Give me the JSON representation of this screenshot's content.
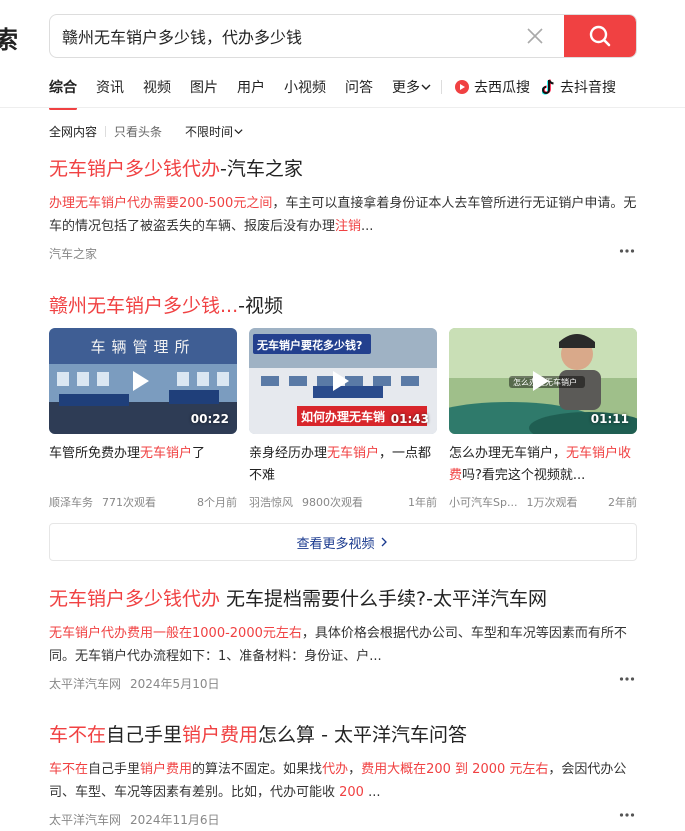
{
  "header": {
    "logo_fragment": "索",
    "search_value": "赣州无车销户多少钱，代办多少钱"
  },
  "tabs": [
    {
      "label": "综合"
    },
    {
      "label": "资讯"
    },
    {
      "label": "视频"
    },
    {
      "label": "图片"
    },
    {
      "label": "用户"
    },
    {
      "label": "小视频"
    },
    {
      "label": "问答"
    }
  ],
  "tab_more_label": "更多",
  "ext_links": [
    {
      "label": "去西瓜搜",
      "icon": "xigua-icon"
    },
    {
      "label": "去抖音搜",
      "icon": "douyin-icon"
    }
  ],
  "filters": [
    "全网内容",
    "只看头条",
    "不限时间"
  ],
  "results": [
    {
      "title_parts": [
        "无车销户多少钱代办",
        "-汽车之家"
      ],
      "snippet_parts": [
        "办理无车销户代办需要200-500元之间",
        "，车主可以直接拿着身份证本人去车管所进行无证销户申请。无车的情况包括了被盗丢失的车辆、报废后没有办理",
        "注销",
        "..."
      ],
      "source": "汽车之家",
      "date": ""
    },
    {
      "title_parts": [
        "无车销户多少钱代办",
        " 无车提档需要什么手续?-太平洋汽车网"
      ],
      "snippet_parts": [
        "无车销户代办费用一般在1000-2000元左右",
        "，具体价格会根据代办公司、车型和车况等因素而有所不同。无车销户代办流程如下：1、准备材料：身份证、户..."
      ],
      "source": "太平洋汽车网",
      "date": "2024年5月10日"
    },
    {
      "title_parts": [
        "车不在",
        "自己手里",
        "销户费用",
        "怎么算 - 太平洋汽车问答"
      ],
      "snippet_parts": [
        "车不在",
        "自己手里",
        "销户费用",
        "的算法不固定。如果找",
        "代办",
        "，",
        "费用大概在200 到 2000 元左右",
        "，会因代办公司、车型、车况等因素有差别。比如，代办可能收 ",
        "200",
        " ..."
      ],
      "source": "太平洋汽车网",
      "date": "2024年11月6日"
    }
  ],
  "video_block": {
    "title_parts": [
      "赣州无车销户多少钱...",
      "-视频"
    ],
    "videos": [
      {
        "title_parts": [
          "车管所免费办理",
          "无车销户",
          "了"
        ],
        "author": "顺泽车务",
        "views": "771次观看",
        "age": "8个月前",
        "duration": "00:22",
        "overlay": "车辆管理所"
      },
      {
        "title_parts": [
          "亲身经历办理",
          "无车销户",
          "，一点都不难"
        ],
        "author": "羽浩惊风",
        "views": "9800次观看",
        "age": "1年前",
        "duration": "01:43",
        "overlay": "无车销户要花多少钱?",
        "overlay2": "如何办理无车销"
      },
      {
        "title_parts": [
          "怎么办理无车销户，",
          "无车销户收费",
          "吗?看完这个视频就..."
        ],
        "author": "小可汽车Sp...",
        "views": "1万次观看",
        "age": "2年前",
        "duration": "01:11",
        "overlay": "怎么办理无车销户"
      }
    ],
    "view_more_label": "查看更多视频"
  },
  "colors": {
    "accent": "#f04142",
    "link_blue": "#1a3a8f"
  }
}
